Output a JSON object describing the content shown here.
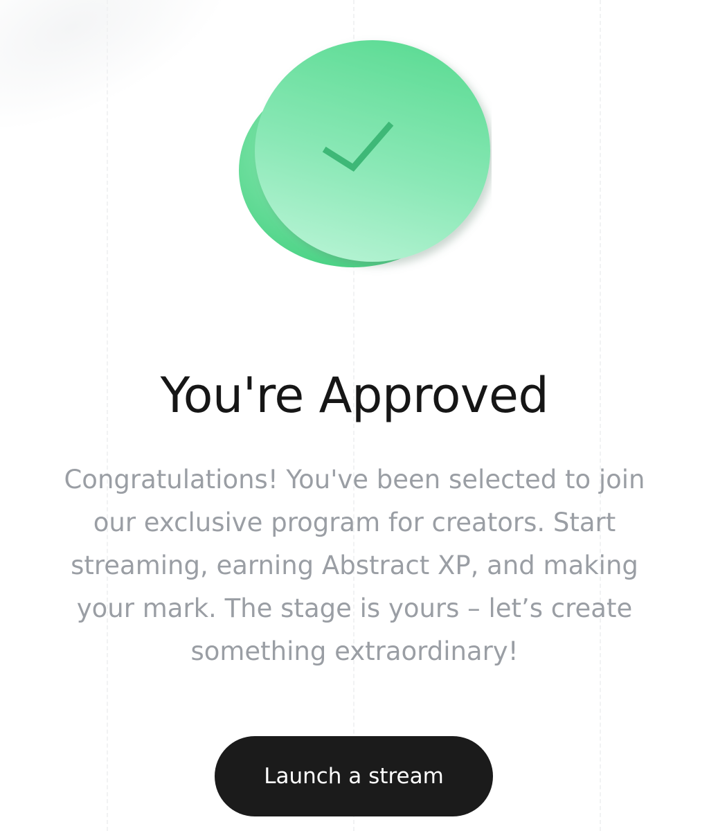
{
  "status_icon": {
    "name": "check-badge-icon",
    "color_main": "#5cdc95",
    "color_light": "#aef0cc",
    "check_color": "#3eb877"
  },
  "heading": "You're Approved",
  "description": "Congratulations! You've been selected to join our exclusive program for creators. Start streaming, earning Abstract XP, and making your mark. The stage is yours – let’s create something extraordinary!",
  "cta": {
    "label": "Launch a stream",
    "color": "#1b1b1b"
  }
}
